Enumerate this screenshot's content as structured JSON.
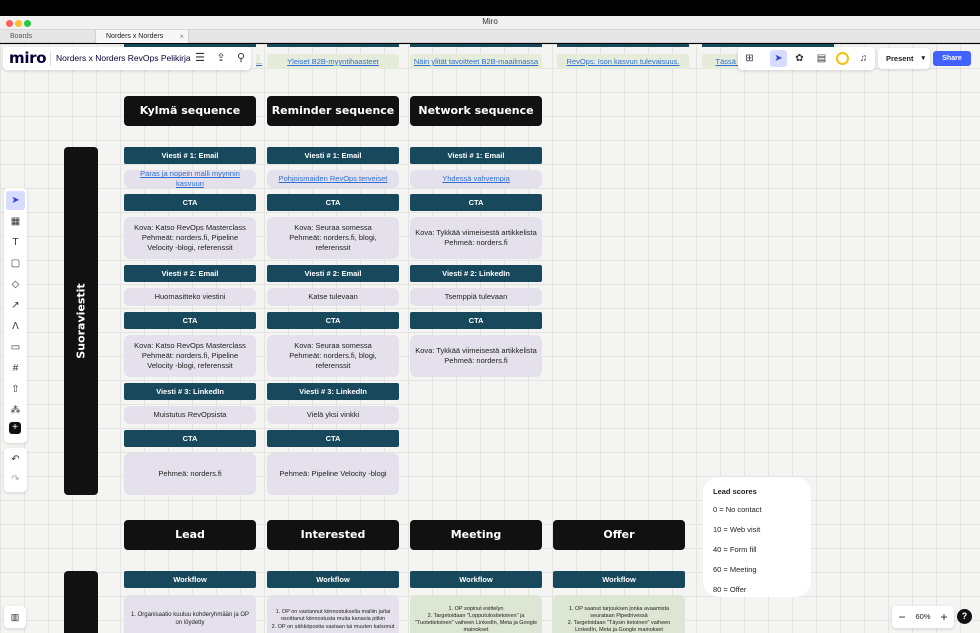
{
  "window": {
    "title": "Miro"
  },
  "tabs": [
    {
      "label": "Boards"
    },
    {
      "label": "Norders x Norders RevOp..."
    }
  ],
  "topbar": {
    "logo": "miro",
    "board_name": "Norders x Norders RevOps Pelikirja"
  },
  "tags": [
    {
      "label": "Yleiset B2B-myyntihaasteet"
    },
    {
      "label": "Näin ylität tavoitteet B2B-maailmassa"
    },
    {
      "label": "RevOps: Ison kasvun tulevaisuus."
    },
    {
      "label": "Tässä o..."
    },
    {
      "label": "..."
    }
  ],
  "columns_top": [
    {
      "header": "Kylmä sequence"
    },
    {
      "header": "Reminder sequence"
    },
    {
      "header": "Network sequence"
    }
  ],
  "side_label": "Suoraviestit",
  "cold": {
    "m1": "Viesti # 1: Email",
    "m1_card": "Paras ja nopein malli myynnin kasvuun",
    "cta1": "CTA",
    "cta1_card": "Kova: Katso RevOps Masterclass\nPehmeät: norders.fi, Pipeline Velocity -blogi, referenssit",
    "m2": "Viesti # 2: Email",
    "m2_card": "Huomasitteko viestini",
    "cta2": "CTA",
    "cta2_card": "Kova: Katso RevOps Masterclass\nPehmeät: norders.fi, Pipeline Velocity -blogi, referenssit",
    "m3": "Viesti # 3: LinkedIn",
    "m3_card": "Muistutus RevOpsista",
    "cta3": "CTA",
    "cta3_card": "Pehmeä: norders.fi"
  },
  "reminder": {
    "m1": "Viesti # 1: Email",
    "m1_card": "Pohjoismaiden RevOps terveiset",
    "cta1": "CTA",
    "cta1_card": "Kova: Seuraa somessa\nPehmeät: norders.fi, blogi, referenssit",
    "m2": "Viesti # 2: Email",
    "m2_card": "Katse tulevaan",
    "cta2": "CTA",
    "cta2_card": "Kova: Seuraa somessa\nPehmeät: norders.fi, blogi, referenssit",
    "m3": "Viesti # 3: LinkedIn",
    "m3_card": "Vielä yksi vinkki",
    "cta3": "CTA",
    "cta3_card": "Pehmeä: Pipeline Velocity -blogi"
  },
  "network": {
    "m1": "Viesti # 1: Email",
    "m1_card": "Yhdessä vahvempia",
    "cta1": "CTA",
    "cta1_card": "Kova: Tykkää viimeisestä artikkelista\nPehmeä: norders.fi",
    "m2": "Viesti # 2: LinkedIn",
    "m2_card": "Tsemppiä tulevaan",
    "cta2": "CTA",
    "cta2_card": "Kova: Tykkää viimeisestä artikkelista\nPehmeä: norders.fi"
  },
  "stages": [
    {
      "header": "Lead",
      "workflow": "Workflow",
      "card": "1. Organisaatio kuuluu kohderyhmään ja OP on löydetty"
    },
    {
      "header": "Interested",
      "workflow": "Workflow",
      "card": "1. OP on vastannut kiinnostuksella mailiin ja/tai osoittanut kiinnostusta muita kanavia pitkin\n2. OP on sähköpostia vastaan tai muuten katsonut"
    },
    {
      "header": "Meeting",
      "workflow": "Workflow",
      "card": "1. OP sopinut esittelyn\n2. Targetoidaan \"Lopputulostietoinen\" ja \"Tuotetietoinen\" vaiheen LinkedIn, Meta ja Google mainokset"
    },
    {
      "header": "Offer",
      "workflow": "Workflow",
      "card": "1. OP saanut tarjouksen jonka avaamista seurataan Pipedrivessä\n2. Targetoidaan \"Täysin tietoinen\" vaiheen LinkedIn, Meta ja Google mainokset"
    }
  ],
  "lead_scores": {
    "title": "Lead scores",
    "items": [
      "0 = No contact",
      "10 = Web visit",
      "40 = Form fill",
      "60 = Meeting",
      "80 = Offer"
    ]
  },
  "toolbar_right": {
    "present_label": "Present",
    "share_label": "Share"
  },
  "zoom": {
    "value": "60%"
  },
  "colors": {
    "label_bg": "#17485c",
    "card_bg": "#e4e1ec",
    "header_bg": "#111111",
    "accent": "#4262ff"
  }
}
